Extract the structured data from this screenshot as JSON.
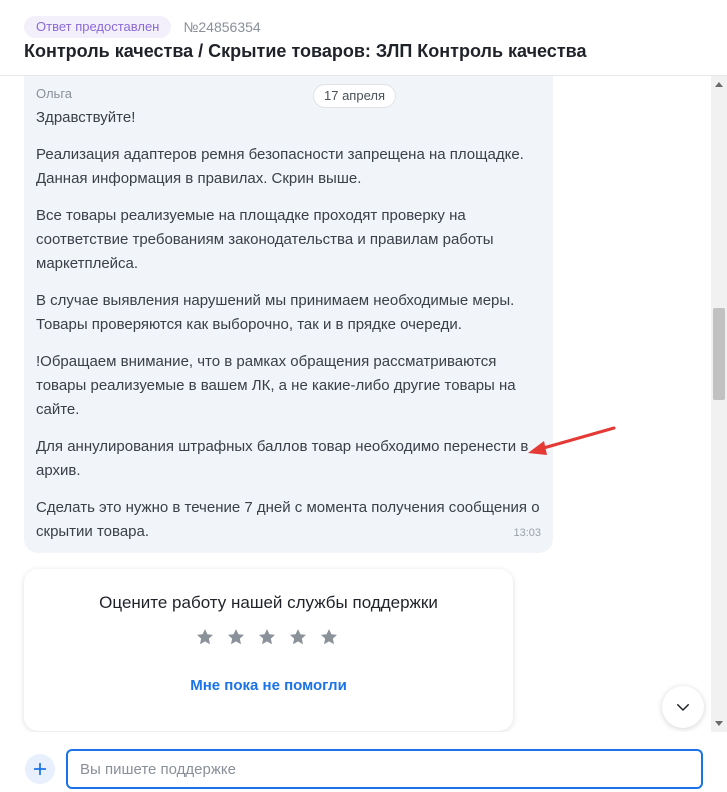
{
  "header": {
    "status": "Ответ предоставлен",
    "ticket_number": "№24856354",
    "title": "Контроль качества / Скрытие товаров: ЗЛП Контроль качества"
  },
  "message": {
    "sender": "Ольга",
    "date": "17 апреля",
    "time": "13:03",
    "paragraphs": [
      "Здравствуйте!",
      "Реализация адаптеров ремня безопасности запрещена на площадке. Данная информация в правилах. Скрин выше.",
      "Все товары реализуемые на площадке проходят проверку на соответствие требованиям законодательства и правилам работы маркетплейса.",
      "В случае выявления нарушений мы принимаем необходимые меры. Товары проверяются как выборочно, так и в прядке очереди.",
      "!Обращаем внимание, что в рамках обращения рассматриваются товары реализуемые в вашем ЛК, а не какие-либо другие товары на сайте.",
      "Для аннулирования штрафных баллов товар необходимо перенести в архив.",
      "Сделать это нужно в течение 7 дней с момента получения сообщения о скрытии товара."
    ]
  },
  "rating": {
    "title": "Оцените работу нашей службы поддержки",
    "not_helped": "Мне пока не помогли",
    "stars_total": 5
  },
  "composer": {
    "placeholder": "Вы пишете поддержке"
  },
  "icons": {
    "star": "star-icon",
    "chevron_down": "chevron-down-icon",
    "plus": "plus-icon",
    "annotation_arrow": "red-arrow-icon"
  },
  "colors": {
    "accent": "#1a73e8",
    "status_text": "#8a6ad8",
    "status_bg": "#f3f0fc",
    "bubble_bg": "#f1f4f8",
    "star": "#8a9199",
    "arrow": "#e53935"
  }
}
